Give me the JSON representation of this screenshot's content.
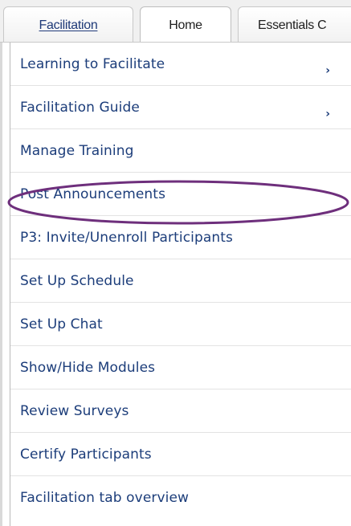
{
  "tabs": [
    {
      "label": "Facilitation"
    },
    {
      "label": "Home"
    },
    {
      "label": "Essentials C"
    }
  ],
  "menu": {
    "items": [
      {
        "label": "Learning to Facilitate",
        "has_submenu": true
      },
      {
        "label": "Facilitation Guide",
        "has_submenu": true
      },
      {
        "label": "Manage Training",
        "has_submenu": false
      },
      {
        "label": "Post Announcements",
        "has_submenu": false,
        "highlighted": true
      },
      {
        "label": "P3: Invite/Unenroll Participants",
        "has_submenu": false
      },
      {
        "label": "Set Up Schedule",
        "has_submenu": false
      },
      {
        "label": "Set Up Chat",
        "has_submenu": false
      },
      {
        "label": "Show/Hide Modules",
        "has_submenu": false
      },
      {
        "label": "Review Surveys",
        "has_submenu": false
      },
      {
        "label": "Certify Participants",
        "has_submenu": false
      },
      {
        "label": "Facilitation tab overview",
        "has_submenu": false
      }
    ],
    "submenu_arrow": "›"
  },
  "colors": {
    "link_text": "#1c3d7a",
    "highlight_ring": "#6e2f7c",
    "tab_active_bg": "#ffffff",
    "tab_bar_bg": "#f0f0f0"
  },
  "icons": {
    "submenu": "chevron-right-icon"
  }
}
